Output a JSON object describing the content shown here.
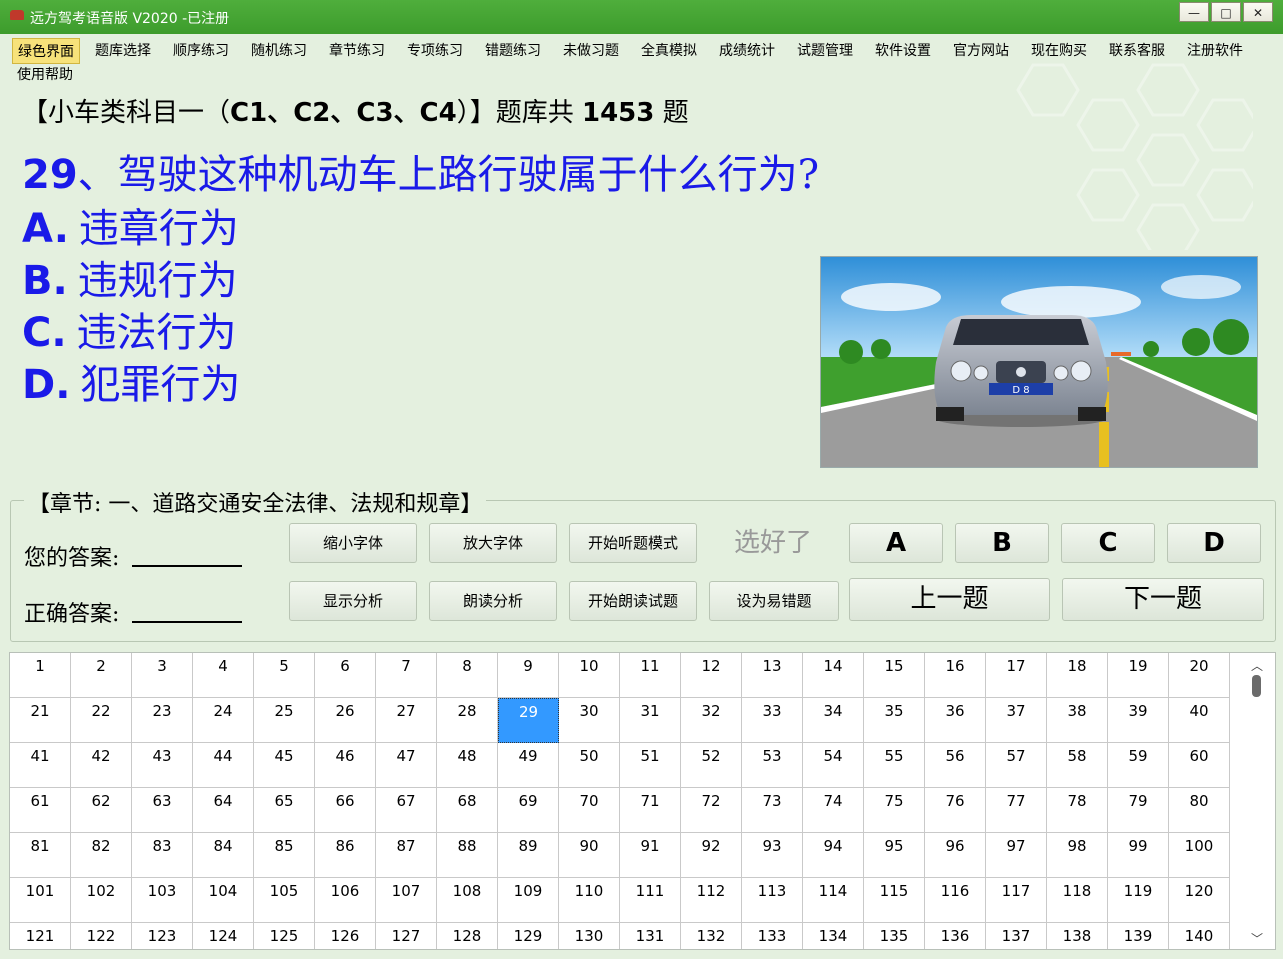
{
  "window": {
    "title": "远方驾考语音版 V2020 -已注册",
    "controls": [
      "—",
      "□",
      "✕"
    ]
  },
  "menu": [
    "绿色界面",
    "题库选择",
    "顺序练习",
    "随机练习",
    "章节练习",
    "专项练习",
    "错题练习",
    "未做习题",
    "全真模拟",
    "成绩统计",
    "试题管理",
    "软件设置",
    "官方网站",
    "现在购买",
    "联系客服",
    "注册软件",
    "使用帮助"
  ],
  "header": {
    "prefix": "【小车类科目一（",
    "category": "C1、C2、C3、C4",
    "middle": "）】题库共 ",
    "count": "1453",
    "suffix": " 题"
  },
  "question": {
    "number": "29",
    "text": "、驾驶这种机动车上路行驶属于什么行为?",
    "options": [
      {
        "letter": "A.",
        "text": "违章行为"
      },
      {
        "letter": "B.",
        "text": "违规行为"
      },
      {
        "letter": "C.",
        "text": "违法行为"
      },
      {
        "letter": "D.",
        "text": "犯罪行为"
      }
    ],
    "plate": "D 8"
  },
  "chapter": {
    "label": "【章节: 一、道路交通安全法律、法规和规章】",
    "your_answer": "您的答案:",
    "correct_answer": "正确答案:"
  },
  "buttons": {
    "shrink_font": "缩小字体",
    "enlarge_font": "放大字体",
    "listen_mode": "开始听题模式",
    "done": "选好了",
    "a": "A",
    "b": "B",
    "c": "C",
    "d": "D",
    "show_analysis": "显示分析",
    "read_analysis": "朗读分析",
    "read_question": "开始朗读试题",
    "mark_error": "设为易错题",
    "prev": "上一题",
    "next": "下一题"
  },
  "grid": {
    "first": 1,
    "last": 140,
    "columns": 20,
    "selected": 29
  },
  "colors": {
    "titlebar": "#4fae3c",
    "question_text": "#1a1ae8",
    "selected_cell": "#3399ff",
    "background": "#e4f0df"
  }
}
